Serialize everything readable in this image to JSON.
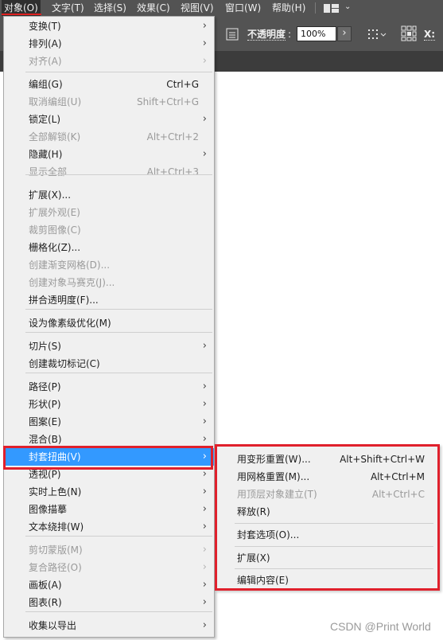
{
  "menubar": {
    "items": [
      "对象(O)",
      "文字(T)",
      "选择(S)",
      "效果(C)",
      "视图(V)",
      "窗口(W)",
      "帮助(H)"
    ],
    "workspace_icon": "grid-layout-icon",
    "colors": {
      "bar": "#535353",
      "text": "#f0f0f0",
      "active_underline": "#e02020"
    }
  },
  "controlbar": {
    "opacity_label": "不透明度",
    "opacity_colon": ":",
    "opacity_value": "100%",
    "x_label": "X:",
    "opacity_button": "›"
  },
  "object_menu": {
    "items": [
      {
        "label": "变换(T)",
        "shortcut": "",
        "submenu": true,
        "disabled": false
      },
      {
        "label": "排列(A)",
        "shortcut": "",
        "submenu": true,
        "disabled": false
      },
      {
        "label": "对齐(A)",
        "shortcut": "",
        "submenu": true,
        "disabled": true
      },
      {
        "label": "编组(G)",
        "shortcut": "Ctrl+G",
        "submenu": false,
        "disabled": false
      },
      {
        "label": "取消编组(U)",
        "shortcut": "Shift+Ctrl+G",
        "submenu": false,
        "disabled": true
      },
      {
        "label": "锁定(L)",
        "shortcut": "",
        "submenu": true,
        "disabled": false
      },
      {
        "label": "全部解锁(K)",
        "shortcut": "Alt+Ctrl+2",
        "submenu": false,
        "disabled": true
      },
      {
        "label": "隐藏(H)",
        "shortcut": "",
        "submenu": true,
        "disabled": false
      },
      {
        "label": "显示全部",
        "shortcut": "Alt+Ctrl+3",
        "submenu": false,
        "disabled": true
      },
      {
        "label": "扩展(X)...",
        "shortcut": "",
        "submenu": false,
        "disabled": false
      },
      {
        "label": "扩展外观(E)",
        "shortcut": "",
        "submenu": false,
        "disabled": true
      },
      {
        "label": "裁剪图像(C)",
        "shortcut": "",
        "submenu": false,
        "disabled": true
      },
      {
        "label": "栅格化(Z)...",
        "shortcut": "",
        "submenu": false,
        "disabled": false
      },
      {
        "label": "创建渐变网格(D)...",
        "shortcut": "",
        "submenu": false,
        "disabled": true
      },
      {
        "label": "创建对象马赛克(J)...",
        "shortcut": "",
        "submenu": false,
        "disabled": true
      },
      {
        "label": "拼合透明度(F)...",
        "shortcut": "",
        "submenu": false,
        "disabled": false
      },
      {
        "label": "设为像素级优化(M)",
        "shortcut": "",
        "submenu": false,
        "disabled": false
      },
      {
        "label": "切片(S)",
        "shortcut": "",
        "submenu": true,
        "disabled": false
      },
      {
        "label": "创建裁切标记(C)",
        "shortcut": "",
        "submenu": false,
        "disabled": false
      },
      {
        "label": "路径(P)",
        "shortcut": "",
        "submenu": true,
        "disabled": false
      },
      {
        "label": "形状(P)",
        "shortcut": "",
        "submenu": true,
        "disabled": false
      },
      {
        "label": "图案(E)",
        "shortcut": "",
        "submenu": true,
        "disabled": false
      },
      {
        "label": "混合(B)",
        "shortcut": "",
        "submenu": true,
        "disabled": false
      },
      {
        "label": "封套扭曲(V)",
        "shortcut": "",
        "submenu": true,
        "disabled": false,
        "selected": true
      },
      {
        "label": "透视(P)",
        "shortcut": "",
        "submenu": true,
        "disabled": false
      },
      {
        "label": "实时上色(N)",
        "shortcut": "",
        "submenu": true,
        "disabled": false
      },
      {
        "label": "图像描摹",
        "shortcut": "",
        "submenu": true,
        "disabled": false
      },
      {
        "label": "文本绕排(W)",
        "shortcut": "",
        "submenu": true,
        "disabled": false
      },
      {
        "label": "剪切蒙版(M)",
        "shortcut": "",
        "submenu": true,
        "disabled": true
      },
      {
        "label": "复合路径(O)",
        "shortcut": "",
        "submenu": true,
        "disabled": true
      },
      {
        "label": "画板(A)",
        "shortcut": "",
        "submenu": true,
        "disabled": false
      },
      {
        "label": "图表(R)",
        "shortcut": "",
        "submenu": true,
        "disabled": false
      },
      {
        "label": "收集以导出",
        "shortcut": "",
        "submenu": true,
        "disabled": false
      }
    ],
    "selected_color": "#3399ff",
    "highlight_border_color": "#e0202c"
  },
  "envelope_submenu": {
    "items": [
      {
        "label": "用变形重置(W)...",
        "shortcut": "Alt+Shift+Ctrl+W",
        "disabled": false
      },
      {
        "label": "用网格重置(M)...",
        "shortcut": "Alt+Ctrl+M",
        "disabled": false
      },
      {
        "label": "用顶层对象建立(T)",
        "shortcut": "Alt+Ctrl+C",
        "disabled": true
      },
      {
        "label": "释放(R)",
        "shortcut": "",
        "disabled": false
      },
      {
        "label": "封套选项(O)...",
        "shortcut": "",
        "disabled": false
      },
      {
        "label": "扩展(X)",
        "shortcut": "",
        "disabled": false
      },
      {
        "label": "编辑内容(E)",
        "shortcut": "",
        "disabled": false
      }
    ]
  },
  "watermark": "CSDN @Print World"
}
